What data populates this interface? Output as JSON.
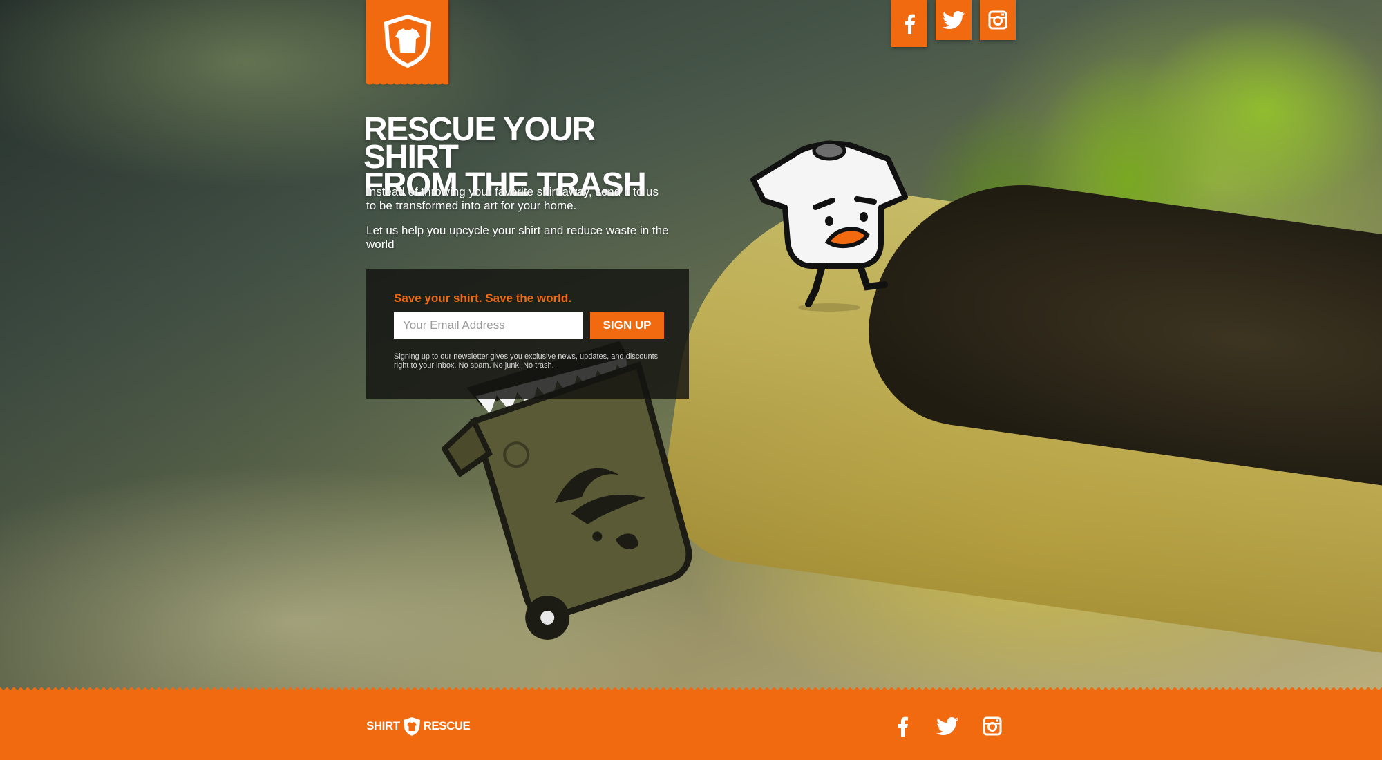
{
  "brand": {
    "footer_logo_left": "SHIRT",
    "footer_logo_right": "RESCUE",
    "accent_color": "#f26a0f"
  },
  "social": [
    {
      "name": "facebook-icon"
    },
    {
      "name": "twitter-icon"
    },
    {
      "name": "instagram-icon"
    }
  ],
  "hero": {
    "headline_line1": "RESCUE YOUR SHIRT",
    "headline_line2": "FROM THE TRASH",
    "intro": "Instead of throwing your favorite shirt away, send it to us to be transformed into art for your home.",
    "intro2": "Let us help you upcycle your shirt and reduce waste in the world"
  },
  "signup": {
    "tagline": "Save your shirt. Save the world.",
    "email_placeholder": "Your Email Address",
    "button_label": "SIGN UP",
    "fine_print": "Signing up to our newsletter gives you exclusive news, updates, and discounts right to your inbox. No spam. No junk. No trash."
  }
}
